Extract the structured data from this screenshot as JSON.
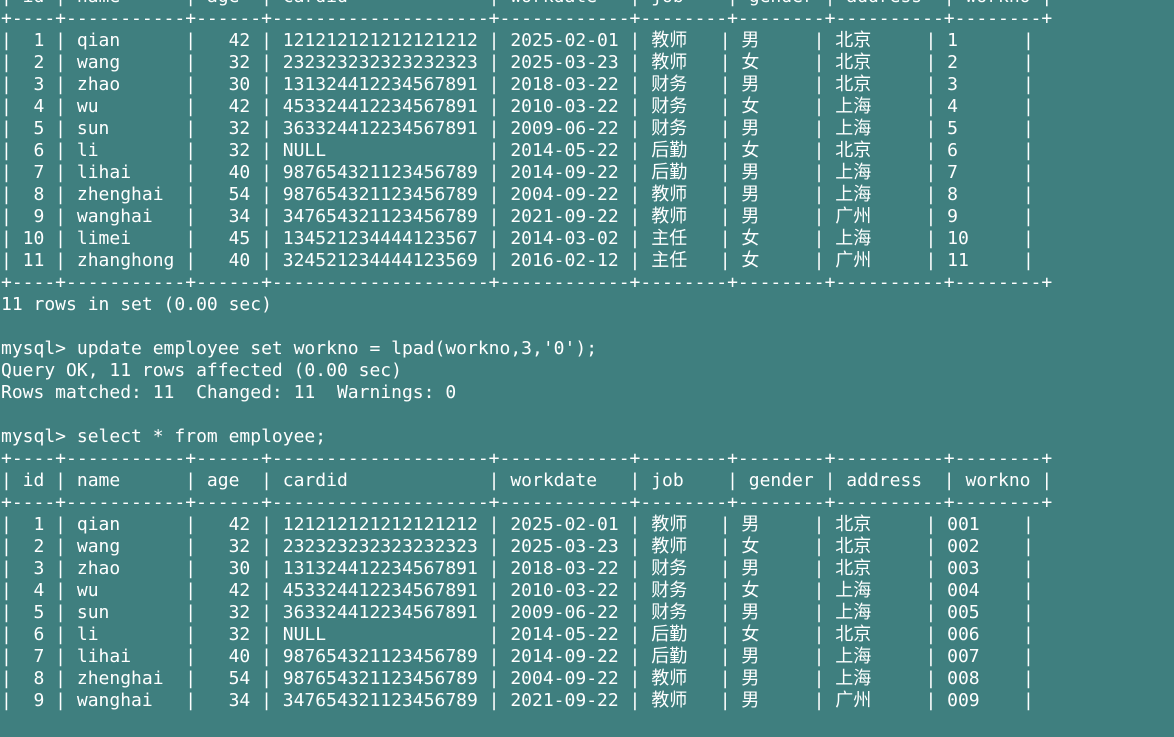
{
  "terminal": {
    "background": "#3f7f7f",
    "foreground": "#ffffff",
    "lines": [
      "| id | name      | age  | cardid             | workdate   | job    | gender | address  | workno |",
      "+----+-----------+------+--------------------+------------+--------+--------+----------+--------+",
      "|  1 | qian      |   42 | 121212121212121212 | 2025-02-01 | 教师   | 男     | 北京     | 1      |",
      "|  2 | wang      |   32 | 232323232323232323 | 2025-03-23 | 教师   | 女     | 北京     | 2      |",
      "|  3 | zhao      |   30 | 131324412234567891 | 2018-03-22 | 财务   | 男     | 北京     | 3      |",
      "|  4 | wu        |   42 | 453324412234567891 | 2010-03-22 | 财务   | 女     | 上海     | 4      |",
      "|  5 | sun       |   32 | 363324412234567891 | 2009-06-22 | 财务   | 男     | 上海     | 5      |",
      "|  6 | li        |   32 | NULL               | 2014-05-22 | 后勤   | 女     | 北京     | 6      |",
      "|  7 | lihai     |   40 | 987654321123456789 | 2014-09-22 | 后勤   | 男     | 上海     | 7      |",
      "|  8 | zhenghai  |   54 | 987654321123456789 | 2004-09-22 | 教师   | 男     | 上海     | 8      |",
      "|  9 | wanghai   |   34 | 347654321123456789 | 2021-09-22 | 教师   | 男     | 广州     | 9      |",
      "| 10 | limei     |   45 | 134521234444123567 | 2014-03-02 | 主任   | 女     | 上海     | 10     |",
      "| 11 | zhanghong |   40 | 324521234444123569 | 2016-02-12 | 主任   | 女     | 广州     | 11     |",
      "+----+-----------+------+--------------------+------------+--------+--------+----------+--------+",
      "11 rows in set (0.00 sec)",
      "",
      "mysql> update employee set workno = lpad(workno,3,'0');",
      "Query OK, 11 rows affected (0.00 sec)",
      "Rows matched: 11  Changed: 11  Warnings: 0",
      "",
      "mysql> select * from employee;",
      "+----+-----------+------+--------------------+------------+--------+--------+----------+--------+",
      "| id | name      | age  | cardid             | workdate   | job    | gender | address  | workno |",
      "+----+-----------+------+--------------------+------------+--------+--------+----------+--------+",
      "|  1 | qian      |   42 | 121212121212121212 | 2025-02-01 | 教师   | 男     | 北京     | 001    |",
      "|  2 | wang      |   32 | 232323232323232323 | 2025-03-23 | 教师   | 女     | 北京     | 002    |",
      "|  3 | zhao      |   30 | 131324412234567891 | 2018-03-22 | 财务   | 男     | 北京     | 003    |",
      "|  4 | wu        |   42 | 453324412234567891 | 2010-03-22 | 财务   | 女     | 上海     | 004    |",
      "|  5 | sun       |   32 | 363324412234567891 | 2009-06-22 | 财务   | 男     | 上海     | 005    |",
      "|  6 | li        |   32 | NULL               | 2014-05-22 | 后勤   | 女     | 北京     | 006    |",
      "|  7 | lihai     |   40 | 987654321123456789 | 2014-09-22 | 后勤   | 男     | 上海     | 007    |",
      "|  8 | zhenghai  |   54 | 987654321123456789 | 2004-09-22 | 教师   | 男     | 上海     | 008    |",
      "|  9 | wanghai   |   34 | 347654321123456789 | 2021-09-22 | 教师   | 男     | 广州     | 009    |"
    ]
  }
}
